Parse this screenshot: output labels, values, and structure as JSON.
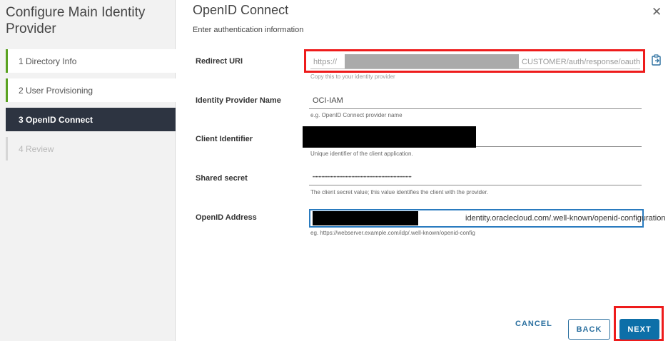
{
  "wizard": {
    "title": "Configure Main Identity Provider",
    "steps": [
      {
        "label": "1  Directory Info",
        "state": "done"
      },
      {
        "label": "2  User Provisioning",
        "state": "done"
      },
      {
        "label": "3  OpenID Connect",
        "state": "active"
      },
      {
        "label": "4  Review",
        "state": "future"
      }
    ]
  },
  "page": {
    "title": "OpenID Connect",
    "subtitle": "Enter authentication information"
  },
  "form": {
    "redirect_uri": {
      "label": "Redirect URI",
      "value_start": "https://",
      "value_end": "CUSTOMER/auth/response/oauth",
      "helper": "Copy this to your identity provider"
    },
    "idp_name": {
      "label": "Identity Provider Name",
      "value": "OCI-IAM",
      "helper": "e.g. OpenID Connect provider name"
    },
    "client_id": {
      "label": "Client Identifier",
      "helper": "Unique identifier of the client application."
    },
    "shared_secret": {
      "label": "Shared secret",
      "value": "••••••••••••••••••••••••••••••••••••••••••••••••••••••••••••••••••",
      "helper": "The client secret value; this value identifies the client with the provider."
    },
    "openid_address": {
      "label": "OpenID Address",
      "value_visible": "identity.oraclecloud.com/.well-known/openid-configuration",
      "helper": "eg. https://webserver.example.com/idp/.well-known/openid-config"
    }
  },
  "footer": {
    "cancel": "CANCEL",
    "back": "BACK",
    "next": "NEXT"
  },
  "colors": {
    "accent": "#0d6fa8",
    "highlight": "#ee1b1b",
    "step_done": "#5aa220",
    "step_active_bg": "#2d3441"
  }
}
